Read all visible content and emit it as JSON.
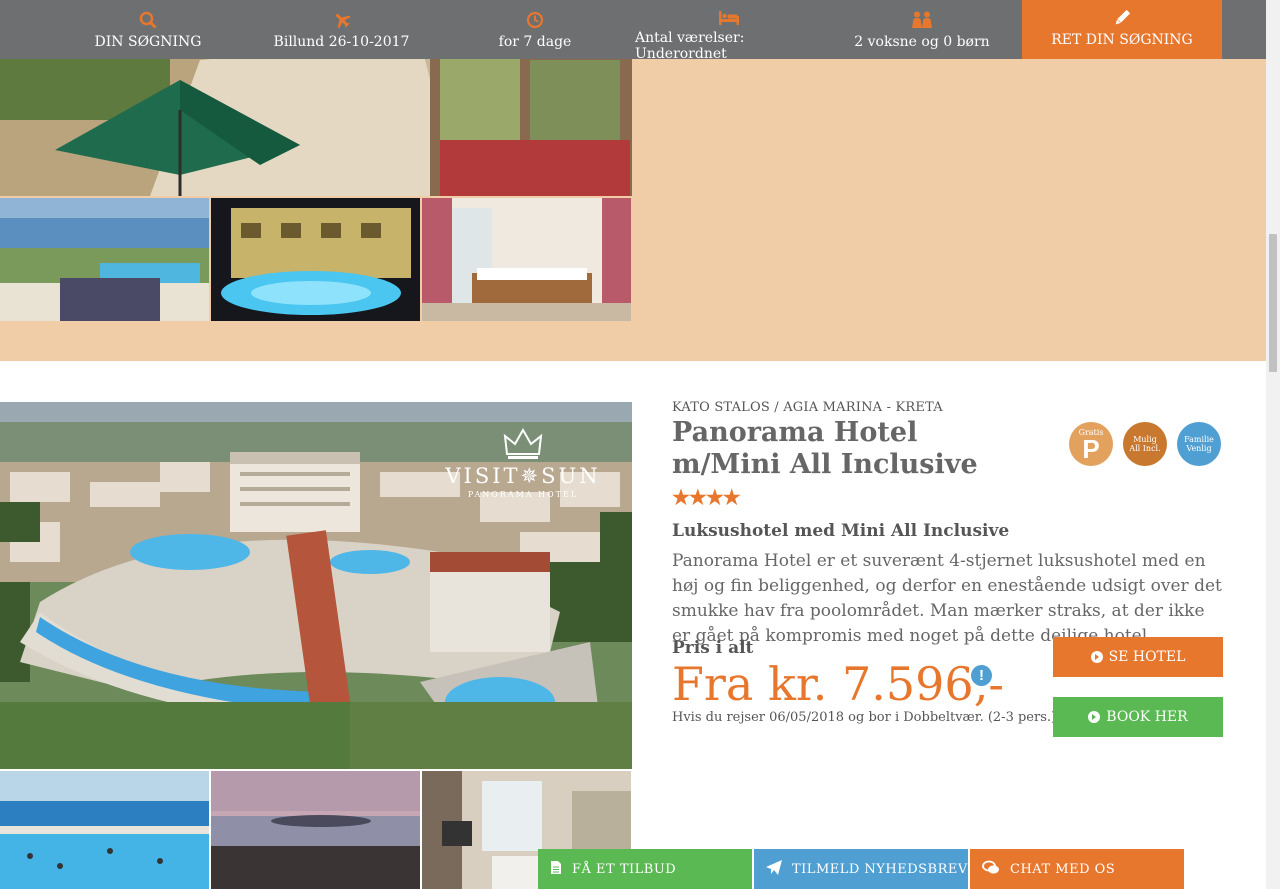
{
  "searchbar": {
    "items": [
      {
        "icon": "search-icon",
        "label": "DIN SØGNING"
      },
      {
        "icon": "plane-icon",
        "label": "Billund 26-10-2017"
      },
      {
        "icon": "clock-icon",
        "label": "for 7 dage"
      },
      {
        "icon": "bed-icon",
        "label": "Antal værelser: Underordnet"
      },
      {
        "icon": "people-icon",
        "label": "2 voksne og 0 børn"
      }
    ],
    "edit_button": {
      "icon": "pencil-icon",
      "label": "RET DIN SØGNING"
    }
  },
  "hotel": {
    "location": "KATO STALOS / AGIA MARINA - KRETA",
    "title": "Panorama Hotel m/Mini All Inclusive",
    "stars": "★★★★",
    "subtitle": "Luksushotel med Mini All Inclusive",
    "description": "Panorama Hotel er et suverænt 4-stjernet luksushotel med en høj og fin beliggenhed, og derfor en enestående udsigt over det smukke hav fra poolområdet. Man mærker straks, at der ikke er gået på kompromis med noget på dette dejlige hotel.",
    "price_label": "Pris i alt",
    "price": "Fra kr. 7.596,-",
    "price_note": "Hvis du rejser 06/05/2018 og bor i Dobbeltvær. (2-3 pers.)",
    "info_icon": "!",
    "photo_brand": "VISIT✵SUN",
    "photo_brand_sub": "PANORAMA HOTEL",
    "badges": [
      {
        "top": "Gratis",
        "main": "P"
      },
      {
        "top": "Mulig",
        "main": "All Incl."
      },
      {
        "top": "Familie",
        "main": "Venlig"
      }
    ],
    "buttons": {
      "see_hotel": "SE HOTEL",
      "book": "BOOK HER"
    }
  },
  "bottombar": {
    "offer": "FÅ ET TILBUD",
    "newsletter": "TILMELD NYHEDSBREV",
    "chat": "CHAT MED OS"
  },
  "colors": {
    "accent": "#e8772e",
    "green": "#5ab952",
    "blue": "#4f9fd3",
    "bar": "#6d6f71",
    "card_bg": "#f0cda6"
  }
}
